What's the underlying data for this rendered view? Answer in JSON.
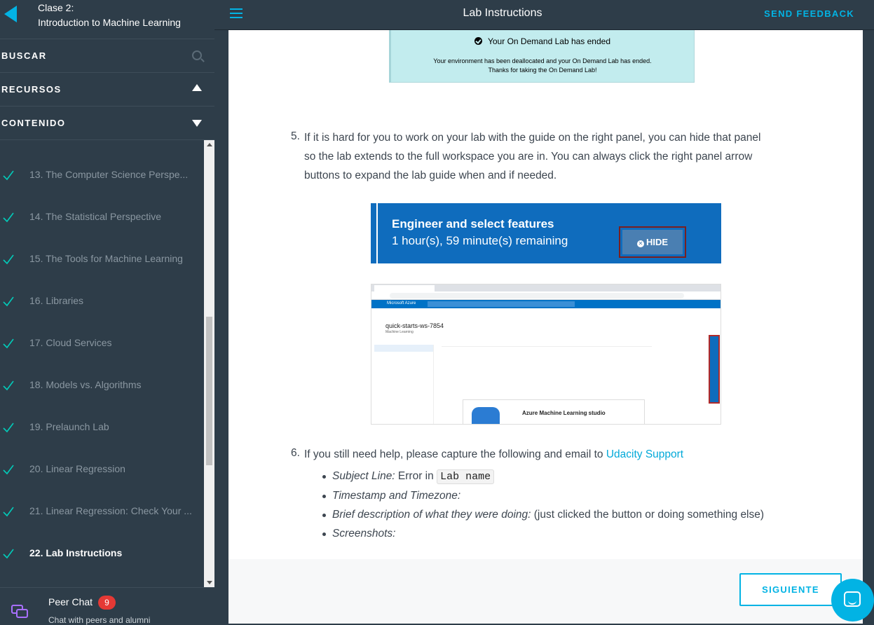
{
  "sidebar": {
    "lesson_number": "Clase 2:",
    "lesson_title": "Introduction to Machine Learning",
    "search_label": "BUSCAR",
    "resources_label": "RECURSOS",
    "contents_label": "CONTENIDO",
    "concepts": [
      {
        "label": "13. The Computer Science Perspe...",
        "done": true,
        "active": false
      },
      {
        "label": "14. The Statistical Perspective",
        "done": true,
        "active": false
      },
      {
        "label": "15. The Tools for Machine Learning",
        "done": true,
        "active": false
      },
      {
        "label": "16. Libraries",
        "done": true,
        "active": false
      },
      {
        "label": "17. Cloud Services",
        "done": true,
        "active": false
      },
      {
        "label": "18. Models vs. Algorithms",
        "done": true,
        "active": false
      },
      {
        "label": "19. Prelaunch Lab",
        "done": true,
        "active": false
      },
      {
        "label": "20. Linear Regression",
        "done": true,
        "active": false
      },
      {
        "label": "21. Linear Regression: Check Your ...",
        "done": true,
        "active": false
      },
      {
        "label": "22. Lab Instructions",
        "done": true,
        "active": true
      }
    ],
    "peer_chat": {
      "title": "Peer Chat",
      "badge": "9",
      "subtitle": "Chat with peers and alumni"
    }
  },
  "topbar": {
    "title": "Lab Instructions",
    "feedback": "SEND FEEDBACK"
  },
  "content": {
    "ended_box": {
      "heading": "Your On Demand Lab has ended",
      "line1": "Your environment has been deallocated and your On Demand Lab has ended.",
      "line2": "Thanks for taking the On Demand Lab!"
    },
    "step5": {
      "num": "5.",
      "line1": "If it is hard for you to work on your lab with the guide on the right panel, you can hide that panel",
      "line2": "so the lab extends to the full workspace you are in. You can always click the right panel arrow",
      "line3": "buttons to expand the lab guide when and if needed."
    },
    "hide_panel": {
      "title": "Engineer and select features",
      "time": "1 hour(s), 59 minute(s) remaining",
      "button": "HIDE"
    },
    "azure": {
      "resource_name": "quick-starts-ws-7854",
      "resource_type": "Machine Learning",
      "studio_title": "Azure Machine Learning studio",
      "portal_label": "Microsoft Azure"
    },
    "step6": {
      "num": "6.",
      "text": "If you still need help, please capture the following and email to ",
      "link": "Udacity Support",
      "bullets": {
        "b1_label": "Subject Line:",
        "b1_text": " Error in ",
        "b1_code": "Lab name",
        "b2_label": "Timestamp and Timezone:",
        "b3_label": "Brief description of what they were doing:",
        "b3_text": " (just clicked the button or doing something else)",
        "b4_label": "Screenshots:"
      }
    }
  },
  "next_button": "SIGUIENTE",
  "colors": {
    "accent": "#02b3e4",
    "sidebar_bg": "#2e3d49",
    "check": "#02ccba"
  }
}
